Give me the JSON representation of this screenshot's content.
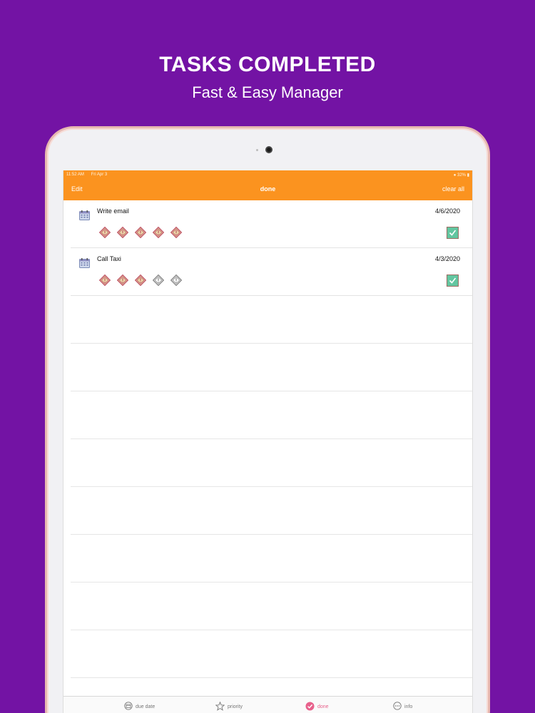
{
  "promo": {
    "title": "TASKS COMPLETED",
    "subtitle": "Fast & Easy Manager"
  },
  "status_bar": {
    "time": "11:52 AM",
    "date": "Fri Apr 3",
    "battery": "32%"
  },
  "nav": {
    "edit_label": "Edit",
    "title": "done",
    "clear_label": "clear all"
  },
  "tasks": [
    {
      "title": "Write email",
      "date": "4/6/2020",
      "priority": 5,
      "priority_max": 5,
      "completed": true
    },
    {
      "title": "Call Taxi",
      "date": "4/3/2020",
      "priority": 3,
      "priority_max": 5,
      "completed": true
    }
  ],
  "tabs": [
    {
      "label": "due date",
      "icon": "calendar-circle-icon",
      "active": false
    },
    {
      "label": "priority",
      "icon": "star-icon",
      "active": false
    },
    {
      "label": "done",
      "icon": "check-badge-icon",
      "active": true
    },
    {
      "label": "info",
      "icon": "more-circle-icon",
      "active": false
    }
  ],
  "colors": {
    "background": "#7313a4",
    "nav_bar": "#fb931f",
    "priority_filled": "#c25a6a",
    "checkbox": "#62c6a0",
    "tab_active": "#e8618c"
  }
}
